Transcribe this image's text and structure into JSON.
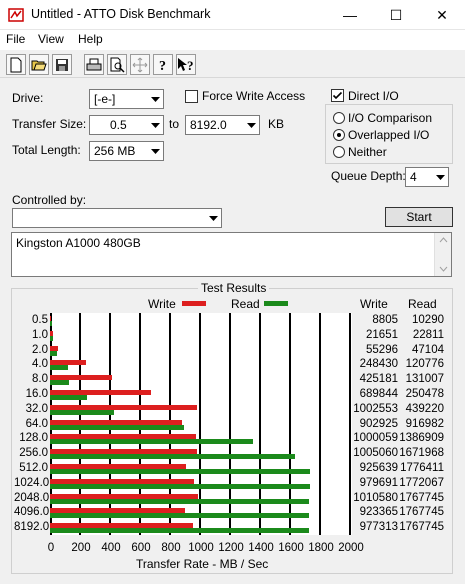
{
  "window": {
    "title": "Untitled - ATTO Disk Benchmark",
    "minimize_glyph": "—",
    "maximize_glyph": "☐",
    "close_glyph": "✕"
  },
  "menu": [
    "File",
    "View",
    "Help"
  ],
  "toolbar": [
    "new-icon",
    "open-icon",
    "save-icon",
    "print-icon",
    "print-preview-icon",
    "move-icon",
    "help-icon",
    "context-help-icon"
  ],
  "settings": {
    "drive_label": "Drive:",
    "drive_value": "[-e-]",
    "transfer_size_label": "Transfer Size:",
    "transfer_from": "0.5",
    "transfer_to_label": "to",
    "transfer_to": "8192.0",
    "transfer_unit": "KB",
    "total_length_label": "Total Length:",
    "total_length_value": "256 MB",
    "force_write_label": "Force Write Access",
    "force_write_checked": false,
    "direct_io_label": "Direct I/O",
    "direct_io_checked": true,
    "io_comparison_label": "I/O Comparison",
    "overlapped_io_label": "Overlapped I/O",
    "neither_label": "Neither",
    "selected_mode": "overlapped",
    "queue_depth_label": "Queue Depth:",
    "queue_depth_value": "4",
    "controlled_by_label": "Controlled by:",
    "controlled_by_value": "",
    "start_label": "Start",
    "description": "Kingston A1000 480GB"
  },
  "results": {
    "title": "Test Results",
    "legend_write": "Write",
    "legend_read": "Read",
    "col_write": "Write",
    "col_read": "Read",
    "write_color": "#dd1f1f",
    "read_color": "#1b8a1b"
  },
  "chart_data": {
    "type": "bar",
    "orientation": "horizontal",
    "categories": [
      "0.5",
      "1.0",
      "2.0",
      "4.0",
      "8.0",
      "16.0",
      "32.0",
      "64.0",
      "128.0",
      "256.0",
      "512.0",
      "1024.0",
      "2048.0",
      "4096.0",
      "8192.0"
    ],
    "series": [
      {
        "name": "Write",
        "values": [
          8805,
          21651,
          55296,
          248430,
          425181,
          689844,
          1002553,
          902925,
          1000059,
          1005060,
          925639,
          979691,
          1010580,
          923365,
          977313
        ]
      },
      {
        "name": "Read",
        "values": [
          10290,
          22811,
          47104,
          120776,
          131007,
          250478,
          439220,
          916982,
          1386909,
          1671968,
          1776411,
          1772067,
          1767745,
          1767745,
          1767745
        ]
      }
    ],
    "xlabel": "Transfer Rate - MB / Sec",
    "xticks": [
      "0",
      "200",
      "400",
      "600",
      "800",
      "1000",
      "1200",
      "1400",
      "1600",
      "1800",
      "2000"
    ],
    "xlim": [
      0,
      2000
    ],
    "grid": true,
    "legend": "top"
  }
}
